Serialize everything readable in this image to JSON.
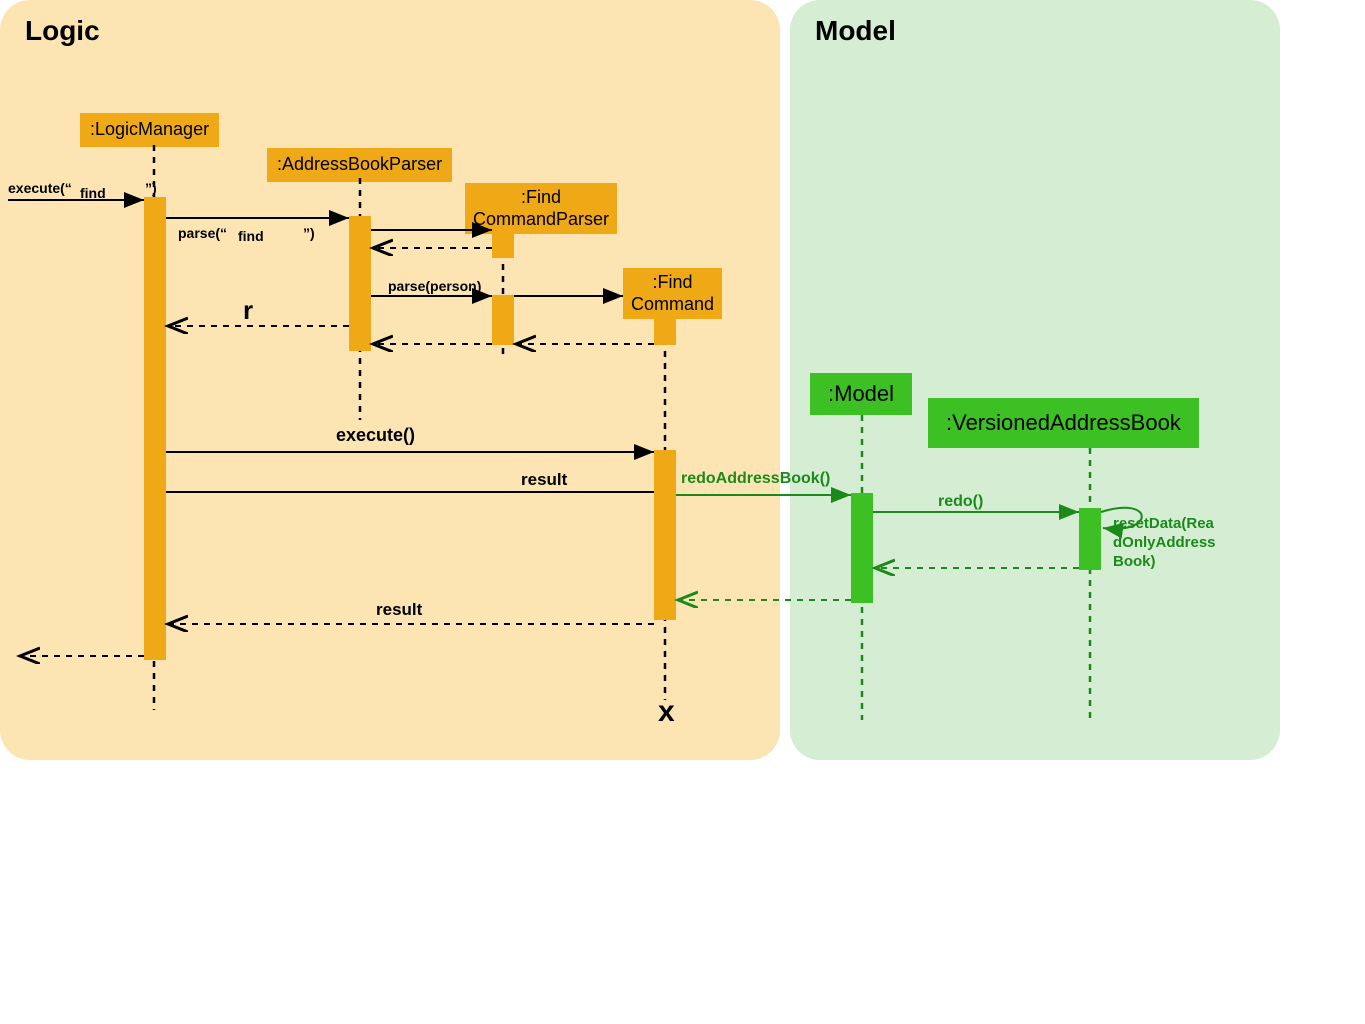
{
  "panels": {
    "logic": {
      "title": "Logic"
    },
    "model": {
      "title": "Model"
    }
  },
  "objects": {
    "logicManager": ":LogicManager",
    "addressBookParser": ":AddressBookParser",
    "findCommandParser": ":Find\nCommandParser",
    "findCommand": ":Find\nCommand",
    "modelObj": ":Model",
    "versionedAddressBook": ":VersionedAddressBook"
  },
  "labels": {
    "executeFindPre": "execute(“",
    "executeFindMid": "find",
    "executeFindPost": "”)",
    "parseFindPre": "parse(“",
    "parseFindMid": "find",
    "parseFindPost": "”)",
    "parsePerson": "parse(person)",
    "r": "r",
    "execute": "execute()",
    "result1": "result",
    "result2": "result",
    "redoAddressBook": "redoAddressBook()",
    "redo": "redo()",
    "resetData": "resetData(Rea\ndOnlyAddress\nBook)",
    "destroy": "x"
  },
  "colors": {
    "orange": "#EFA917",
    "green": "#3DC024",
    "greenDark": "#1B8A1B",
    "panelLogic": "#FCE5B3",
    "panelModel": "#D5EDD2"
  }
}
